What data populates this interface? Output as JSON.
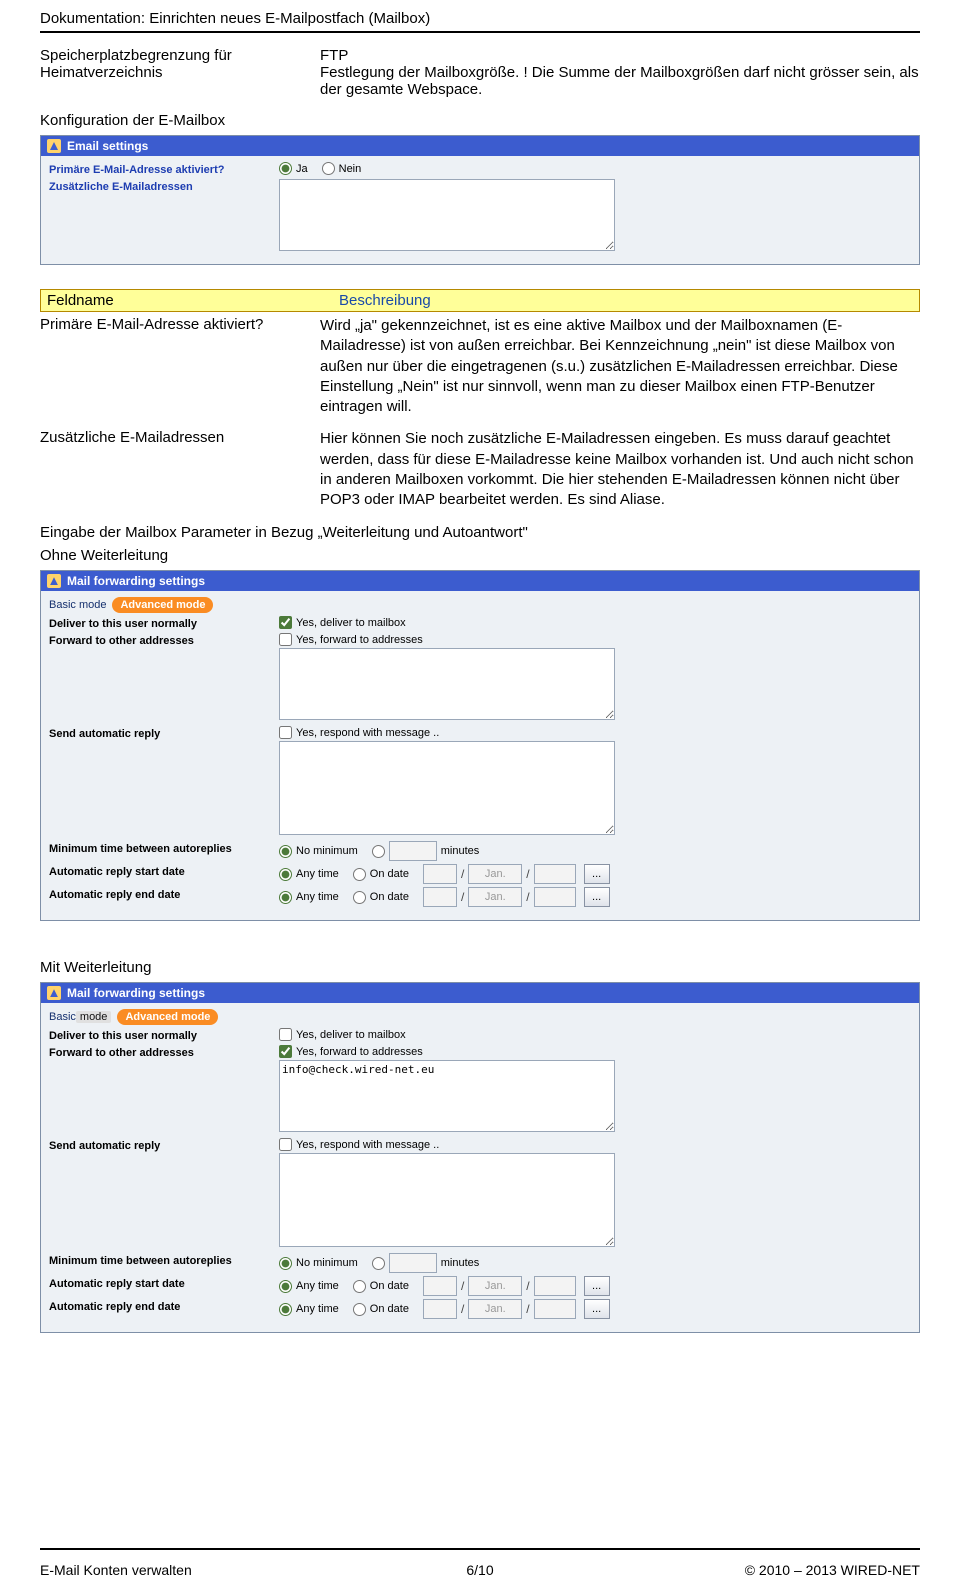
{
  "doc_header": "Dokumentation: Einrichten neues E-Mailpostfach (Mailbox)",
  "def1": {
    "left": "Speicherplatzbegrenzung für Heimatverzeichnis",
    "right": "FTP\nFestlegung der Mailboxgröße. ! Die Summe der Mailboxgrößen darf nicht grösser sein, als der gesamte Webspace."
  },
  "section_konfig": "Konfiguration der E-Mailbox",
  "email_panel": {
    "title": "Email settings",
    "row1_label": "Primäre E-Mail-Adresse aktiviert?",
    "row1_opt_yes": "Ja",
    "row1_opt_no": "Nein",
    "row2_label": "Zusätzliche E-Mailadressen",
    "textarea_value": ""
  },
  "field_table": {
    "col1": "Feldname",
    "col2": "Beschreibung"
  },
  "desc_rows": [
    {
      "left": "Primäre E-Mail-Adresse aktiviert?",
      "right": "Wird „ja\" gekennzeichnet, ist es eine aktive Mailbox und der Mailboxnamen (E-Mailadresse) ist von außen erreichbar. Bei Kennzeichnung „nein\" ist diese Mailbox von außen nur über die eingetragenen (s.u.) zusätzlichen E-Mailadressen erreichbar. Diese Einstellung „Nein\" ist nur sinnvoll, wenn man zu dieser Mailbox einen FTP-Benutzer eintragen will."
    },
    {
      "left": "Zusätzliche E-Mailadressen",
      "right": "Hier können Sie noch zusätzliche E-Mailadressen eingeben. Es muss darauf geachtet werden, dass für diese E-Mailadresse keine Mailbox vorhanden ist. Und auch nicht schon in anderen Mailboxen vorkommt. Die hier stehenden E-Mailadressen können nicht über POP3 oder IMAP bearbeitet werden. Es sind Aliase."
    }
  ],
  "section_forward": "Eingabe der Mailbox Parameter in Bezug „Weiterleitung und Autoantwort\"",
  "section_ohne": "Ohne Weiterleitung",
  "section_mit": "Mit Weiterleitung",
  "fwd_panel": {
    "title": "Mail forwarding settings",
    "basic": "Basic mode",
    "basic_word": "Basic",
    "mode_word": "mode",
    "advanced": "Advanced mode",
    "deliver_label": "Deliver to this user normally",
    "deliver_cb": "Yes, deliver to mailbox",
    "forward_label": "Forward to other addresses",
    "forward_cb": "Yes, forward to addresses",
    "forward_value2": "info@check.wired-net.eu",
    "autoreply_label": "Send automatic reply",
    "autoreply_cb": "Yes, respond with message ..",
    "mintime_label": "Minimum time between autoreplies",
    "mintime_nomin": "No minimum",
    "mintime_unit": "minutes",
    "start_label": "Automatic reply start date",
    "end_label": "Automatic reply end date",
    "anytime": "Any time",
    "ondate": "On date",
    "month": "Jan.",
    "slash": "/",
    "ellipsis": "..."
  },
  "footer": {
    "left": "E-Mail Konten verwalten",
    "center": "6/10",
    "right": "© 2010 – 2013 WIRED-NET"
  }
}
